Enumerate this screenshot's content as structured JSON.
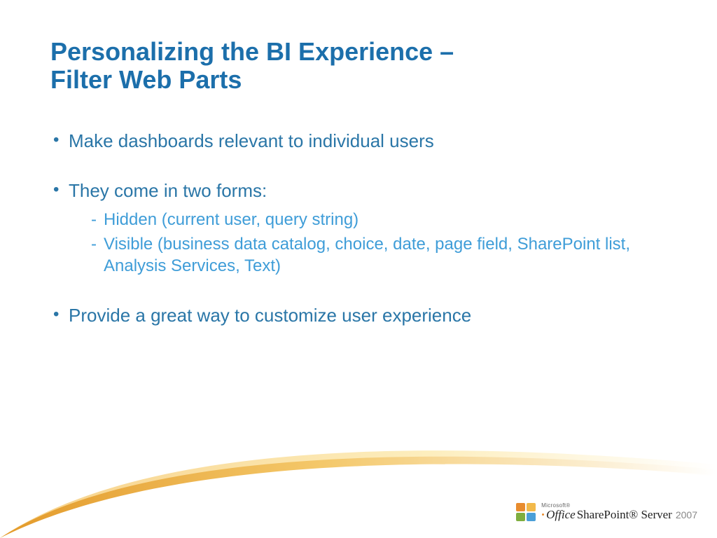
{
  "title_line1": "Personalizing the BI Experience –",
  "title_line2": "Filter Web Parts",
  "bullets": {
    "b1": "Make dashboards relevant to individual users",
    "b2": "They come in two forms:",
    "b2_sub1": "Hidden (current user, query string)",
    "b2_sub2": "Visible (business data catalog, choice, date, page field, SharePoint list, Analysis Services, Text)",
    "b3": "Provide a great way to customize user experience"
  },
  "logo": {
    "vendor": "Microsoft®",
    "brand": "Office",
    "product": "SharePoint® Server",
    "year": "2007"
  }
}
